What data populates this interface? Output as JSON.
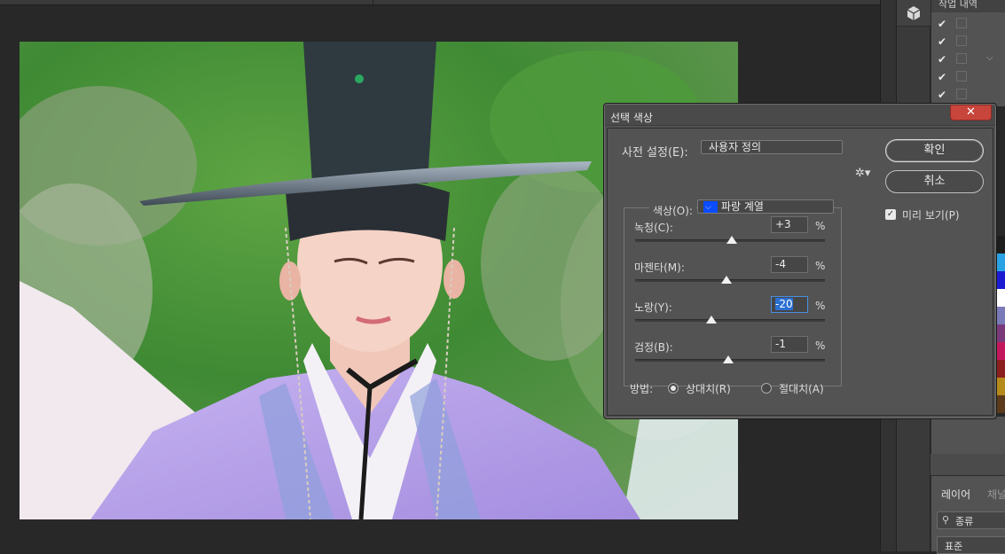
{
  "panels": {
    "history_tab": "작업 내역",
    "history_rows": [
      {
        "checked": true
      },
      {
        "checked": true
      },
      {
        "checked": true
      },
      {
        "checked": true
      },
      {
        "checked": true
      }
    ],
    "layers_tab": "레이어",
    "channels_tab": "채널",
    "layers_search": "종류",
    "layers_blend": "표준"
  },
  "dialog": {
    "title": "선택 색상",
    "close_glyph": "✕",
    "preset_label": "사전 설정(E):",
    "preset_value": "사용자 정의",
    "colors_label": "색상(O):",
    "colors_value": "파랑 계열",
    "colors_chip": "#0a4cff",
    "sliders": [
      {
        "label": "녹청(C):",
        "value": "+3",
        "unit": "%",
        "level": 0.51
      },
      {
        "label": "마젠타(M):",
        "value": "-4",
        "unit": "%",
        "level": 0.48
      },
      {
        "label": "노랑(Y):",
        "value": "-20",
        "unit": "%",
        "level": 0.4
      },
      {
        "label": "검정(B):",
        "value": "-1",
        "unit": "%",
        "level": 0.49
      }
    ],
    "method_label": "방법:",
    "method_relative": "상대치(R)",
    "method_absolute": "절대치(A)",
    "ok_label": "확인",
    "cancel_label": "취소",
    "preview_label": "미리 보기(P)",
    "preview_checked": true,
    "method_selected": "relative"
  },
  "swatch_colors": [
    "#1d1d1d",
    "#2aa3e6",
    "#1a1ad0",
    "#ffffff",
    "#7a7ab8",
    "#7a3a7a",
    "#c2185b",
    "#8b1e1e",
    "#b58b1a",
    "#5a3a1a"
  ]
}
